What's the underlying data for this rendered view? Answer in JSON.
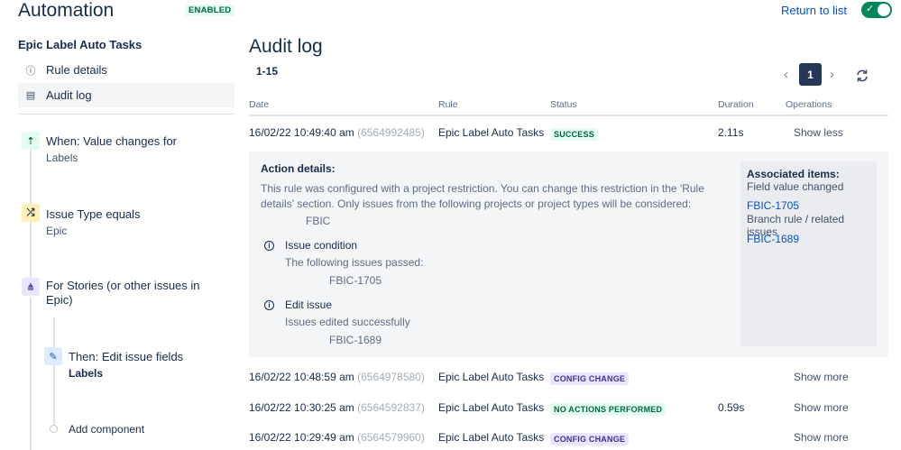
{
  "header": {
    "title": "Automation",
    "badge": "ENABLED",
    "return_label": "Return to list",
    "toggle_check": "✓"
  },
  "sidebar": {
    "rule_name": "Epic Label Auto Tasks",
    "nav": [
      {
        "label": "Rule details",
        "icon": "info-icon",
        "glyph": "ⓘ"
      },
      {
        "label": "Audit log",
        "icon": "document-icon",
        "glyph": "▤"
      }
    ],
    "steps": [
      {
        "title": "When: Value changes for",
        "sub": "Labels",
        "icon": "trigger-icon",
        "glyph": "⇡",
        "color": "#e3fcef",
        "fg": "#006644"
      },
      {
        "title": "Issue Type equals",
        "sub": "Epic",
        "icon": "shuffle-icon",
        "glyph": "⤮",
        "color": "#fff0b3",
        "fg": "#172b4d"
      },
      {
        "title": "For Stories (or other issues in",
        "title2": "Epic)",
        "icon": "branch-icon",
        "glyph": "⋔",
        "color": "#eae6ff",
        "fg": "#403294"
      },
      {
        "title": "Then: Edit issue fields",
        "sub": "Labels",
        "icon": "pencil-icon",
        "glyph": "✎",
        "color": "#deebff",
        "fg": "#0052cc"
      }
    ],
    "add_component": "Add component"
  },
  "main": {
    "title": "Audit log",
    "range": "1-15",
    "pagination": {
      "prev": "‹",
      "page": "1",
      "next": "›"
    },
    "columns": [
      "Date",
      "Rule",
      "Status",
      "Duration",
      "Operations"
    ],
    "rows": [
      {
        "date": "16/02/22 10:49:40 am",
        "id": "(6564992485)",
        "rule": "Epic Label Auto Tasks",
        "status": "SUCCESS",
        "status_type": "success",
        "duration": "2.11s",
        "op": "Show less"
      },
      {
        "date": "16/02/22 10:48:59 am",
        "id": "(6564978580)",
        "rule": "Epic Label Auto Tasks",
        "status": "CONFIG CHANGE",
        "status_type": "config",
        "duration": "",
        "op": "Show more"
      },
      {
        "date": "16/02/22 10:30:25 am",
        "id": "(6564592837)",
        "rule": "Epic Label Auto Tasks",
        "status": "NO ACTIONS PERFORMED",
        "status_type": "noact",
        "duration": "0.59s",
        "op": "Show more"
      },
      {
        "date": "16/02/22 10:29:49 am",
        "id": "(6564579960)",
        "rule": "Epic Label Auto Tasks",
        "status": "CONFIG CHANGE",
        "status_type": "config",
        "duration": "",
        "op": "Show more"
      }
    ],
    "details": {
      "title": "Action details:",
      "message": "This rule was configured with a project restriction. You can change this restriction in the 'Rule details' section. Only issues from the following projects or project types will be considered:",
      "project": "FBIC",
      "items": [
        {
          "title": "Issue condition",
          "desc": "The following issues passed:",
          "issue": "FBIC-1705"
        },
        {
          "title": "Edit issue",
          "desc": "Issues edited successfully",
          "issue": "FBIC-1689"
        }
      ],
      "associated": {
        "title": "Associated items:",
        "groups": [
          {
            "label": "Field value changed",
            "link": "FBIC-1705"
          },
          {
            "label": "Branch rule / related issues",
            "link": "FBIC-1689"
          }
        ]
      }
    }
  }
}
